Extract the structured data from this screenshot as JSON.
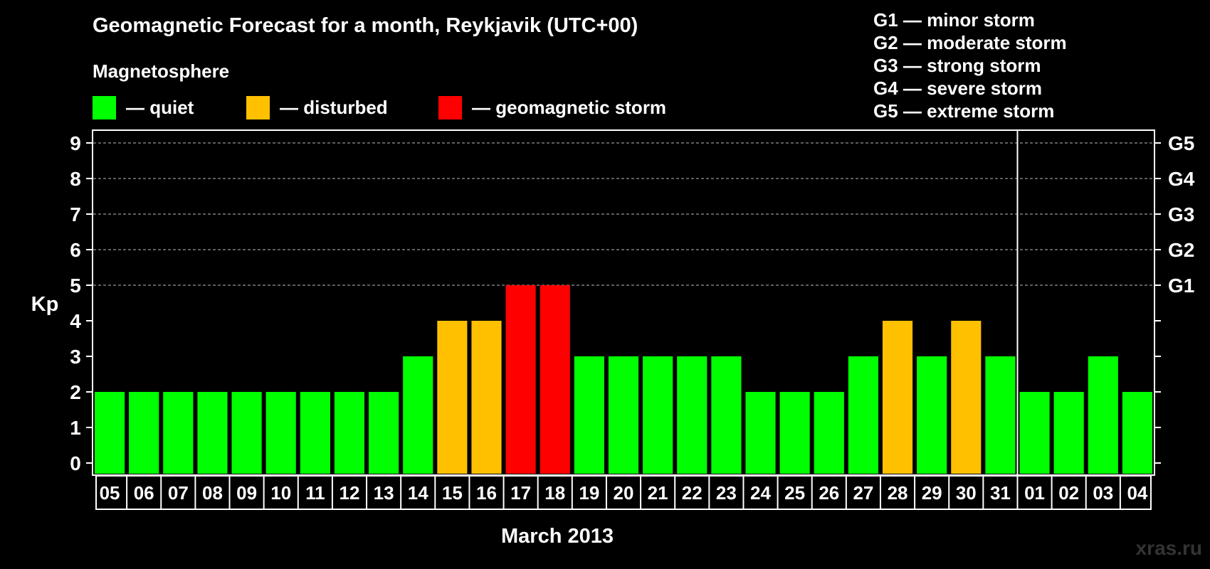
{
  "title": "Geomagnetic Forecast for a month, Reykjavik (UTC+00)",
  "legend": {
    "heading": "Magnetosphere",
    "items": [
      {
        "key": "quiet",
        "label": "— quiet",
        "color": "#00ff00"
      },
      {
        "key": "disturbed",
        "label": "— disturbed",
        "color": "#ffc000"
      },
      {
        "key": "storm",
        "label": "— geomagnetic storm",
        "color": "#ff0000"
      }
    ]
  },
  "storm_scale": [
    "G1 — minor storm",
    "G2 — moderate storm",
    "G3 — strong storm",
    "G4 — severe storm",
    "G5 — extreme storm"
  ],
  "watermark": "xras.ru",
  "chart_data": {
    "type": "bar",
    "ylabel": "Kp",
    "xlabel": "March 2013",
    "ylim": [
      0,
      9
    ],
    "yticks": [
      "0",
      "1",
      "2",
      "3",
      "4",
      "5",
      "6",
      "7",
      "8",
      "9"
    ],
    "right_axis_labels": [
      {
        "kp": 5,
        "label": "G1"
      },
      {
        "kp": 6,
        "label": "G2"
      },
      {
        "kp": 7,
        "label": "G3"
      },
      {
        "kp": 8,
        "label": "G4"
      },
      {
        "kp": 9,
        "label": "G5"
      }
    ],
    "grid": "dashed horizontal lines at Kp 5 to 9",
    "month_boundary_after": "31",
    "categories": [
      "05",
      "06",
      "07",
      "08",
      "09",
      "10",
      "11",
      "12",
      "13",
      "14",
      "15",
      "16",
      "17",
      "18",
      "19",
      "20",
      "21",
      "22",
      "23",
      "24",
      "25",
      "26",
      "27",
      "28",
      "29",
      "30",
      "31",
      "01",
      "02",
      "03",
      "04"
    ],
    "values": [
      2,
      2,
      2,
      2,
      2,
      2,
      2,
      2,
      2,
      3,
      4,
      4,
      5,
      5,
      3,
      3,
      3,
      3,
      3,
      2,
      2,
      2,
      3,
      4,
      3,
      4,
      3,
      2,
      2,
      3,
      2
    ],
    "color_rule": {
      "quiet": "Kp < 4",
      "disturbed": "Kp = 4",
      "storm": "Kp >= 5"
    }
  }
}
